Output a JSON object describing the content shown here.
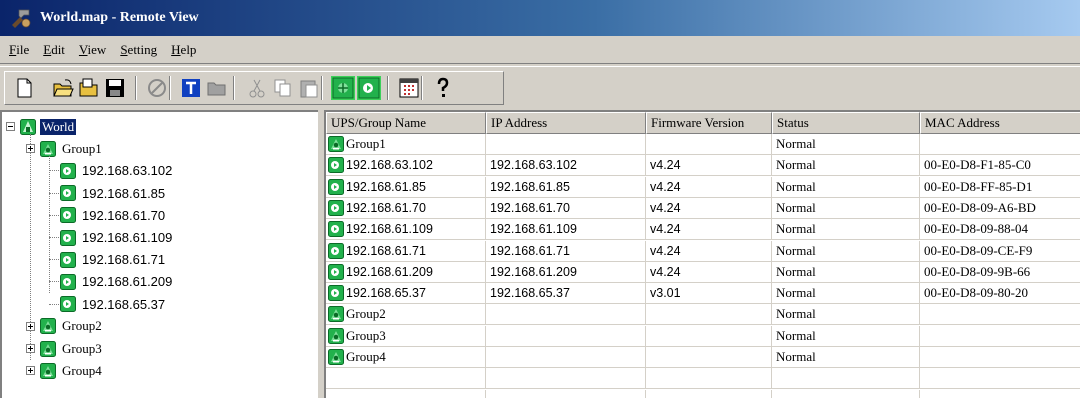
{
  "window": {
    "title": "World.map - Remote View"
  },
  "menu": [
    {
      "label": "File",
      "key": "F",
      "rest": "ile"
    },
    {
      "label": "Edit",
      "key": "E",
      "rest": "dit"
    },
    {
      "label": "View",
      "key": "V",
      "rest": "iew"
    },
    {
      "label": "Setting",
      "key": "S",
      "rest": "etting"
    },
    {
      "label": "Help",
      "key": "H",
      "rest": "elp"
    }
  ],
  "toolbar": {
    "buttons": [
      {
        "name": "new-map-button",
        "icon": "new-document-icon",
        "enabled": true
      },
      {
        "name": "open-button",
        "icon": "open-folder-icon",
        "enabled": true
      },
      {
        "name": "open-remote-button",
        "icon": "folder-icon",
        "enabled": true
      },
      {
        "name": "save-button",
        "icon": "floppy-disk-icon",
        "enabled": true
      },
      {
        "name": "disconnect-button",
        "icon": "no-entry-icon",
        "enabled": false
      },
      {
        "name": "text-button",
        "icon": "text-t-icon",
        "enabled": true
      },
      {
        "name": "folder-gray-button",
        "icon": "gray-folder-icon",
        "enabled": false
      },
      {
        "name": "cut-button",
        "icon": "scissors-icon",
        "enabled": false
      },
      {
        "name": "copy-button",
        "icon": "copy-icon",
        "enabled": false
      },
      {
        "name": "paste-button",
        "icon": "paste-icon",
        "enabled": false
      },
      {
        "name": "group-view-button",
        "icon": "green-group-icon",
        "enabled": true
      },
      {
        "name": "ups-view-button",
        "icon": "green-ups-icon",
        "enabled": true
      },
      {
        "name": "calendar-button",
        "icon": "calendar-icon",
        "enabled": true
      },
      {
        "name": "help-button",
        "icon": "question-mark-icon",
        "enabled": true
      }
    ]
  },
  "tree": {
    "root": {
      "label": "World",
      "selected": true
    },
    "nodes": [
      {
        "label": "Group1",
        "type": "group",
        "level": 1,
        "expander": "plus"
      },
      {
        "label": "192.168.63.102",
        "type": "ups",
        "level": 2
      },
      {
        "label": "192.168.61.85",
        "type": "ups",
        "level": 2
      },
      {
        "label": "192.168.61.70",
        "type": "ups",
        "level": 2
      },
      {
        "label": "192.168.61.109",
        "type": "ups",
        "level": 2
      },
      {
        "label": "192.168.61.71",
        "type": "ups",
        "level": 2
      },
      {
        "label": "192.168.61.209",
        "type": "ups",
        "level": 2
      },
      {
        "label": "192.168.65.37",
        "type": "ups",
        "level": 2
      },
      {
        "label": "Group2",
        "type": "group",
        "level": 1,
        "expander": "plus"
      },
      {
        "label": "Group3",
        "type": "group",
        "level": 1,
        "expander": "plus"
      },
      {
        "label": "Group4",
        "type": "group",
        "level": 1,
        "expander": "plus"
      }
    ]
  },
  "list": {
    "columns": [
      "UPS/Group Name",
      "IP Address",
      "Firmware Version",
      "Status",
      "MAC Address"
    ],
    "rows": [
      {
        "type": "group",
        "cells": [
          "Group1",
          "",
          "",
          "Normal",
          ""
        ]
      },
      {
        "type": "ups",
        "cells": [
          "192.168.63.102",
          "192.168.63.102",
          "v4.24",
          "Normal",
          "00-E0-D8-F1-85-C0"
        ]
      },
      {
        "type": "ups",
        "cells": [
          "192.168.61.85",
          "192.168.61.85",
          "v4.24",
          "Normal",
          "00-E0-D8-FF-85-D1"
        ]
      },
      {
        "type": "ups",
        "cells": [
          "192.168.61.70",
          "192.168.61.70",
          "v4.24",
          "Normal",
          "00-E0-D8-09-A6-BD"
        ]
      },
      {
        "type": "ups",
        "cells": [
          "192.168.61.109",
          "192.168.61.109",
          "v4.24",
          "Normal",
          "00-E0-D8-09-88-04"
        ]
      },
      {
        "type": "ups",
        "cells": [
          "192.168.61.71",
          "192.168.61.71",
          "v4.24",
          "Normal",
          "00-E0-D8-09-CE-F9"
        ]
      },
      {
        "type": "ups",
        "cells": [
          "192.168.61.209",
          "192.168.61.209",
          "v4.24",
          "Normal",
          "00-E0-D8-09-9B-66"
        ]
      },
      {
        "type": "ups",
        "cells": [
          "192.168.65.37",
          "192.168.65.37",
          "v3.01",
          "Normal",
          "00-E0-D8-09-80-20"
        ]
      },
      {
        "type": "group",
        "cells": [
          "Group2",
          "",
          "",
          "Normal",
          ""
        ]
      },
      {
        "type": "group",
        "cells": [
          "Group3",
          "",
          "",
          "Normal",
          ""
        ]
      },
      {
        "type": "group",
        "cells": [
          "Group4",
          "",
          "",
          "Normal",
          ""
        ]
      }
    ]
  },
  "colors": {
    "title_gradient_start": "#0a246a",
    "title_gradient_end": "#a6caf0",
    "selection": "#0a246a",
    "ups_green": "#22b14c",
    "window_face": "#d4d0c8"
  }
}
